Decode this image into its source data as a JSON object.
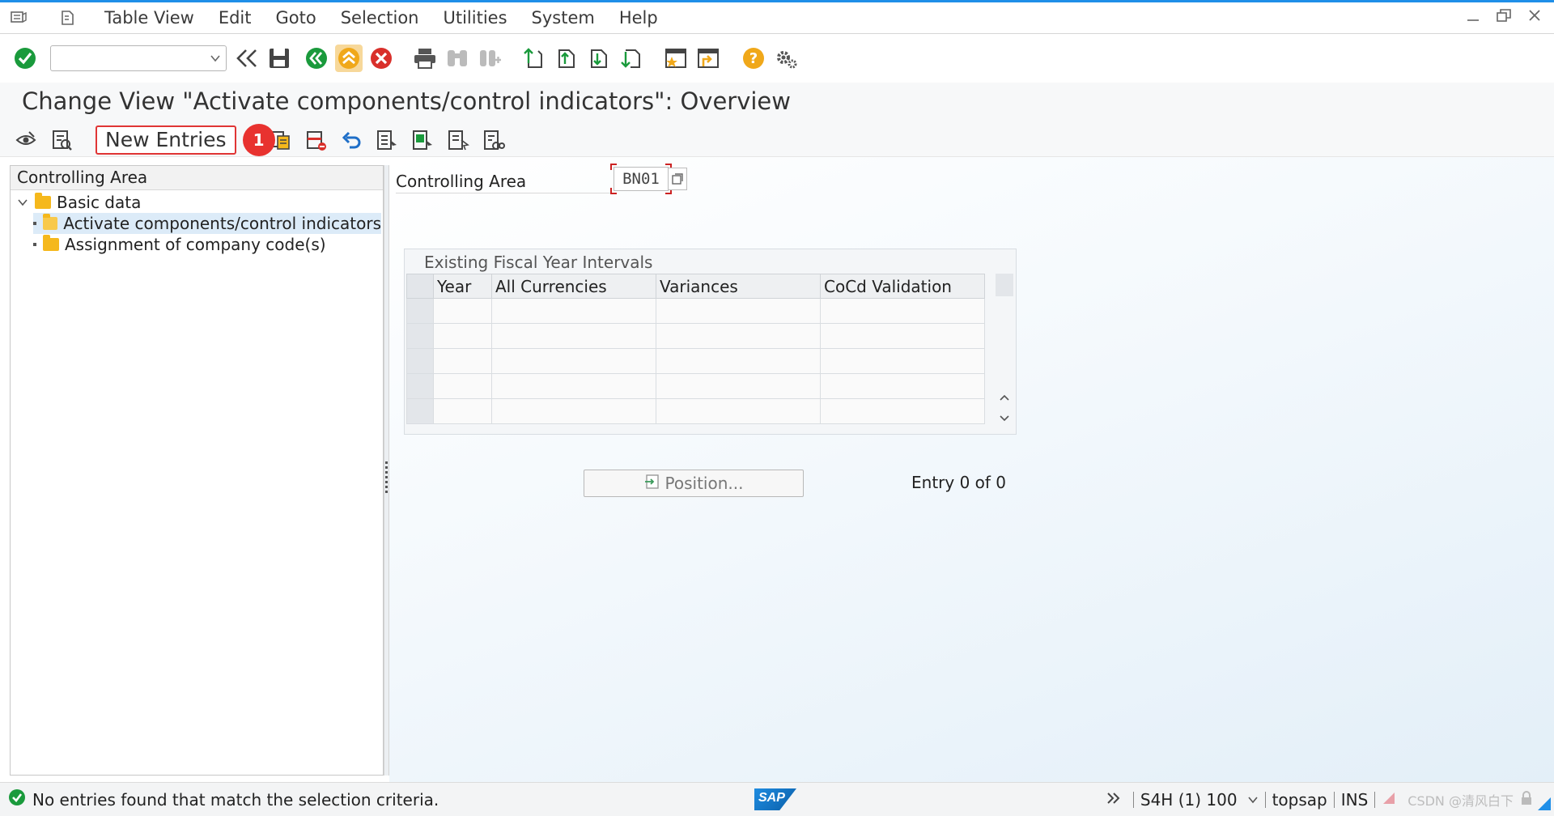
{
  "menubar": {
    "items": [
      "Table View",
      "Edit",
      "Goto",
      "Selection",
      "Utilities",
      "System",
      "Help"
    ]
  },
  "toolbar": {
    "command_field_value": "",
    "icons": [
      "enter-icon",
      "back-chevrons-icon",
      "save-icon",
      "back-icon",
      "exit-icon",
      "cancel-icon",
      "print-icon",
      "find-icon",
      "find-next-icon",
      "first-page-icon",
      "previous-page-icon",
      "next-page-icon",
      "last-page-icon",
      "new-session-icon",
      "shortcut-icon",
      "help-icon",
      "settings-icon"
    ]
  },
  "title": "Change View \"Activate components/control indicators\": Overview",
  "app_toolbar": {
    "new_entries_label": "New Entries",
    "step_badge": "1"
  },
  "nav": {
    "header": "Controlling Area",
    "root": "Basic data",
    "items": [
      "Activate components/control indicators",
      "Assignment of company code(s)"
    ]
  },
  "content": {
    "controlling_area_label": "Controlling Area",
    "controlling_area_value": "BN01",
    "table_title": "Existing Fiscal Year Intervals",
    "columns": [
      "Year",
      "All Currencies",
      "Variances",
      "CoCd Validation"
    ],
    "position_button": "Position...",
    "entry_count": "Entry 0 of 0"
  },
  "status": {
    "message": "No entries found that match the selection criteria.",
    "sap_logo": "SAP",
    "system": "S4H (1) 100",
    "server": "topsap",
    "mode": "INS",
    "watermark": "CSDN @清风白下"
  },
  "colors": {
    "accent": "#1f8fe8",
    "highlight_red": "#e03535",
    "success_green": "#1a9a3c"
  }
}
